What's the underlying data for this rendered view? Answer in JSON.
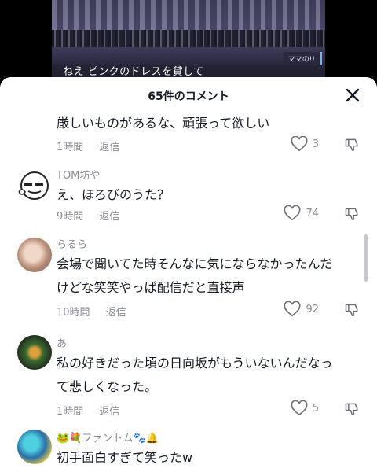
{
  "video": {
    "subtitle": "ねえ ピンクのドレスを貸して",
    "tag": "ママの!!"
  },
  "panel": {
    "title": "65件のコメント"
  },
  "comments": [
    {
      "username": "",
      "text_lines": [
        "厳しいものがあるな、頑張って欲しい"
      ],
      "time": "1時間",
      "reply_label": "返信",
      "likes": "3"
    },
    {
      "username": "TOM坊や",
      "text_lines": [
        "え、ほろびのうた？"
      ],
      "time": "9時間",
      "reply_label": "返信",
      "likes": "74"
    },
    {
      "username": "らるら",
      "text_lines": [
        "会場で聞いてた時そんなに気にならなかったんだ",
        "けどな笑笑やっぱ配信だと直接声"
      ],
      "time": "10時間",
      "reply_label": "返信",
      "likes": "92"
    },
    {
      "username": "あ",
      "text_lines": [
        "私の好きだった頃の日向坂がもういないんだなっ",
        "て悲しくなった。"
      ],
      "time": "1時間",
      "reply_label": "返信",
      "likes": "5"
    },
    {
      "username": "🐸💐ファントム🐾🔔",
      "text_lines": [
        "初手面白すぎて笑ったw"
      ],
      "time": "",
      "reply_label": "",
      "likes": ""
    }
  ]
}
